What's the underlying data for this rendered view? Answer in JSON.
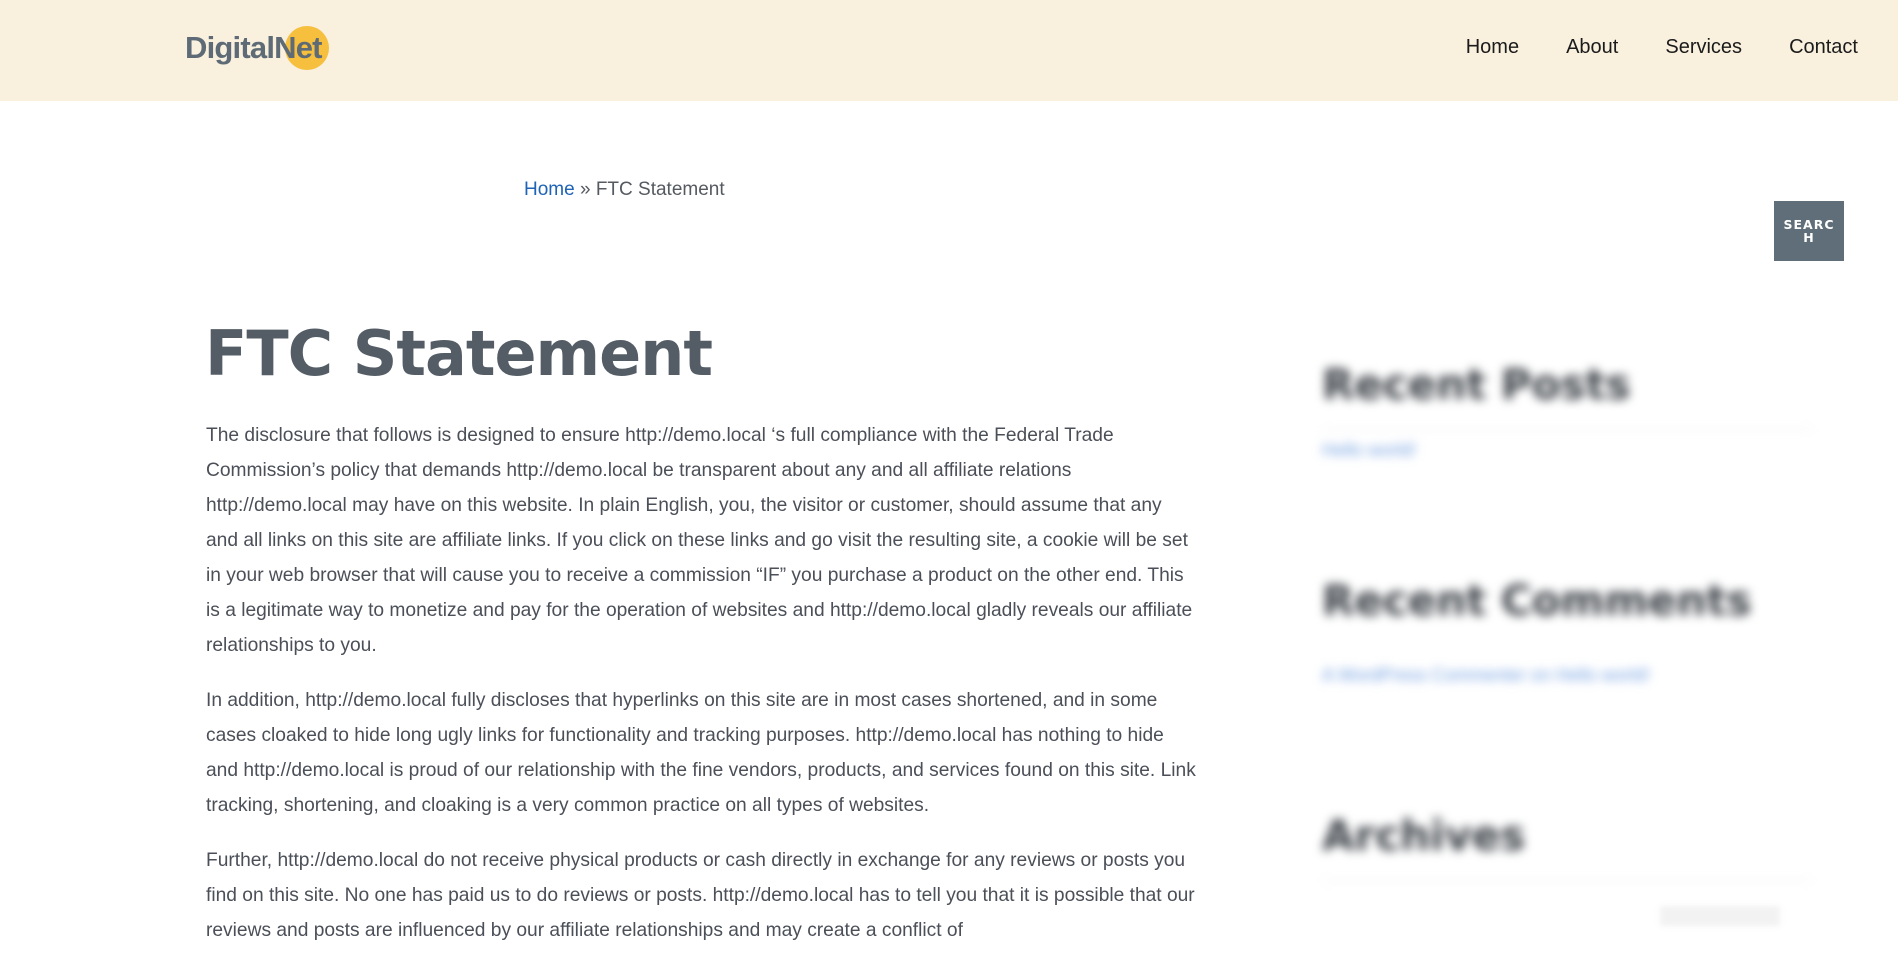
{
  "site": {
    "logo_text": "DigitalNet"
  },
  "nav": {
    "items": [
      "Home",
      "About",
      "Services",
      "Contact"
    ]
  },
  "breadcrumb": {
    "home_label": "Home",
    "separator": "»",
    "current": "FTC Statement"
  },
  "search": {
    "label": "SEARCH"
  },
  "page": {
    "title": "FTC Statement",
    "paragraphs": [
      "The disclosure that follows is designed to ensure http://demo.local ‘s full compliance with the Federal Trade Commission’s policy that demands http://demo.local be transparent about any and all affiliate relations http://demo.local may have on this website. In plain English, you, the visitor or customer, should assume that any and all links on this site are affiliate links. If you click on these links and go visit the resulting site, a cookie will be set in your web browser that will cause you to receive a commission “IF” you purchase a product on the other end. This is a legitimate way to monetize and pay for the operation of websites and http://demo.local gladly reveals our affiliate relationships to you.",
      "In addition, http://demo.local fully discloses that hyperlinks on this site are in most cases shortened, and in some cases cloaked to hide long ugly links for functionality and tracking purposes. http://demo.local has nothing to hide and http://demo.local is proud of our relationship with the fine vendors, products, and services found on this site. Link tracking, shortening, and cloaking is a very common practice on all types of websites.",
      "Further, http://demo.local do not receive physical products or cash directly in exchange for any reviews or posts you find on this site. No one has paid us to do reviews or posts. http://demo.local has to tell you that it is possible that our reviews and posts are influenced by our affiliate relationships and may create a conflict of"
    ]
  },
  "sidebar": {
    "recent_posts_title": "Recent Posts",
    "recent_posts_link": "Hello world!",
    "recent_comments_title": "Recent Comments",
    "recent_comments_link": "A WordPress Commenter on Hello world!",
    "archives_title": "Archives"
  },
  "colors": {
    "header_bg": "#f9f0de",
    "logo_accent": "#f6bf3e",
    "link": "#1e63b5",
    "search_bg": "#5f6e78"
  }
}
